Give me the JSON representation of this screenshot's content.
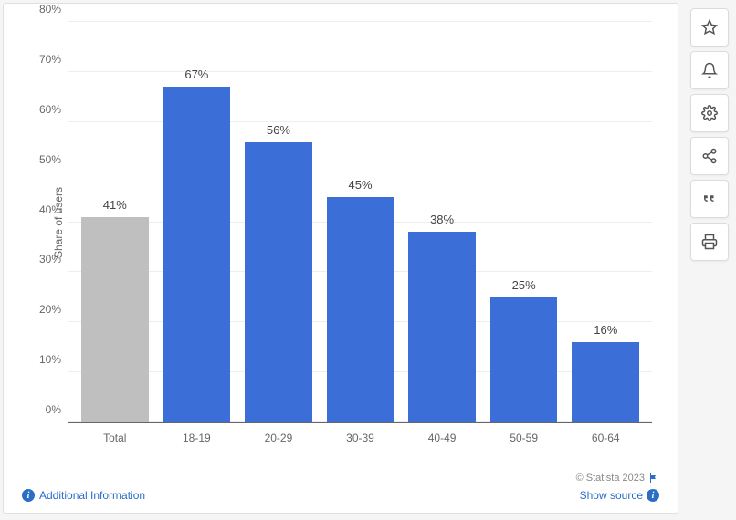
{
  "chart_data": {
    "type": "bar",
    "categories": [
      "Total",
      "18-19",
      "20-29",
      "30-39",
      "40-49",
      "50-59",
      "60-64"
    ],
    "values": [
      41,
      67,
      56,
      45,
      38,
      25,
      16
    ],
    "value_labels": [
      "41%",
      "67%",
      "56%",
      "45%",
      "38%",
      "25%",
      "16%"
    ],
    "title": "",
    "xlabel": "",
    "ylabel": "Share of users",
    "ylim": [
      0,
      80
    ],
    "y_ticks": [
      0,
      10,
      20,
      30,
      40,
      50,
      60,
      70,
      80
    ],
    "y_tick_labels": [
      "0%",
      "10%",
      "20%",
      "30%",
      "40%",
      "50%",
      "60%",
      "70%",
      "80%"
    ],
    "colors": {
      "total": "#bfbfbf",
      "default": "#3b6ed6"
    }
  },
  "footer": {
    "additional_info": "Additional Information",
    "copyright": "© Statista 2023",
    "show_source": "Show source"
  },
  "toolbar": {
    "favorite": "star",
    "alert": "bell",
    "settings": "gear",
    "share": "share",
    "cite": "quote",
    "print": "print"
  }
}
